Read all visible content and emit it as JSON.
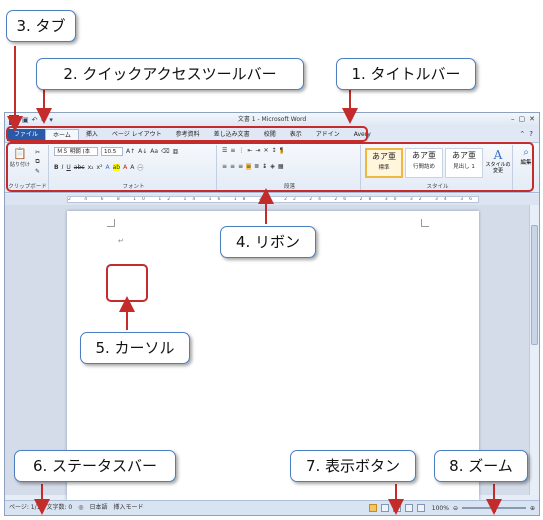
{
  "callouts": {
    "tab": "3. タブ",
    "qat": "2. クイックアクセスツールバー",
    "title": "1. タイトルバー",
    "ribbon": "4. リボン",
    "cursor": "5. カーソル",
    "status": "6. ステータスバー",
    "view": "7. 表示ボタン",
    "zoom": "8. ズーム"
  },
  "window": {
    "title": "文書 1 - Microsoft Word",
    "app_icon": "W"
  },
  "tabs": [
    "ファイル",
    "ホーム",
    "挿入",
    "ページ レイアウト",
    "参考資料",
    "差し込み文書",
    "校閲",
    "表示",
    "アドイン",
    "Avery"
  ],
  "ribbon": {
    "groups": {
      "clipboard": "クリップボード",
      "font": "フォント",
      "paragraph": "段落",
      "styles": "スタイル"
    },
    "paste_label": "貼り付け",
    "font_name": "ＭＳ 明朝 (本",
    "font_size": "10.5",
    "styles": [
      {
        "sample": "あア亜",
        "name": "標準"
      },
      {
        "sample": "あア亜",
        "name": "行間詰め"
      },
      {
        "sample": "あア亜",
        "name": "見出し 1"
      }
    ],
    "change_styles": "スタイルの\n変更",
    "edit_label": "編集"
  },
  "status": {
    "page": "ページ: 1/1",
    "words": "文字数: 0",
    "language": "日本語",
    "mode": "挿入モード",
    "zoom": "100%"
  },
  "colors": {
    "callout_border": "#4b7fc0",
    "highlight_red": "#c42c2c",
    "file_tab": "#2a5aa7"
  }
}
